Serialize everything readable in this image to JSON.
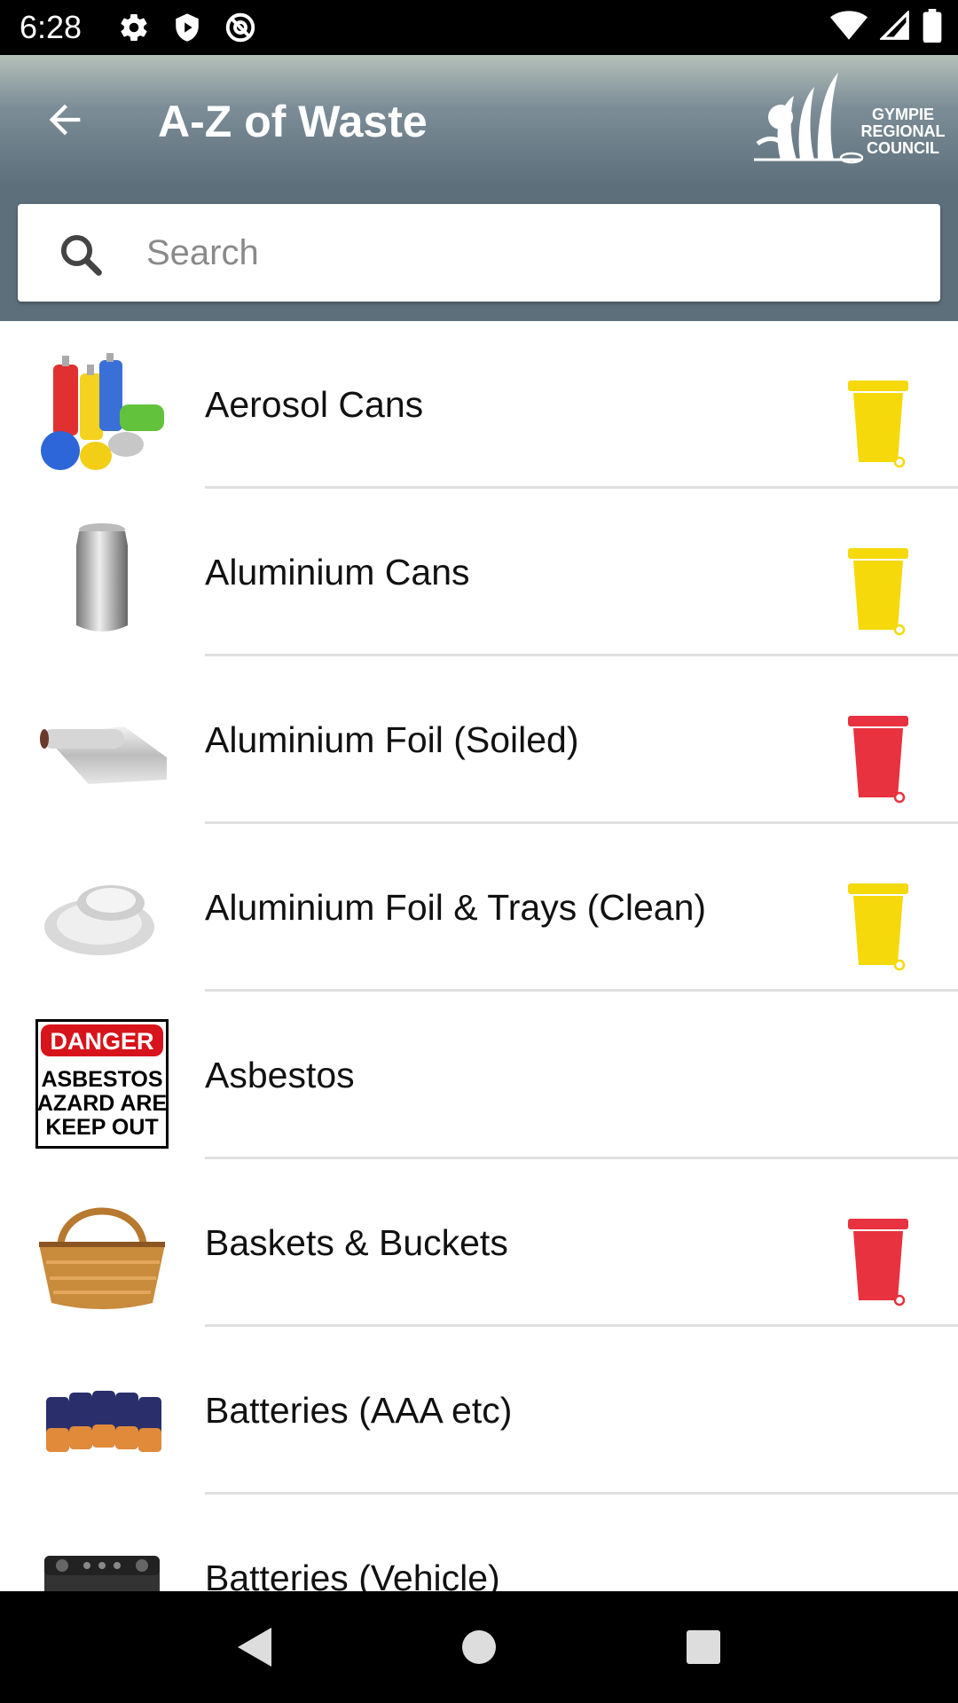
{
  "status_bar": {
    "time": "6:28",
    "left_icons": [
      "settings-icon",
      "shield-play-icon",
      "at-sign-icon"
    ],
    "right_icons": [
      "wifi-icon",
      "signal-icon",
      "battery-icon"
    ]
  },
  "app_bar": {
    "title": "A-Z of Waste",
    "back_icon": "arrow-back-icon",
    "logo_text": [
      "GYMPIE",
      "REGIONAL",
      "COUNCIL"
    ]
  },
  "search": {
    "placeholder": "Search",
    "value": ""
  },
  "colors": {
    "yellow_bin": "#f5d90a",
    "red_bin": "#e8323f",
    "header_dark": "#5d6f7b"
  },
  "items": [
    {
      "label": "Aerosol Cans",
      "bin": "yellow",
      "thumb": "aerosol-cans-image"
    },
    {
      "label": "Aluminium Cans",
      "bin": "yellow",
      "thumb": "aluminium-can-image"
    },
    {
      "label": "Aluminium Foil (Soiled)",
      "bin": "red",
      "thumb": "foil-roll-image"
    },
    {
      "label": "Aluminium Foil & Trays (Clean)",
      "bin": "yellow",
      "thumb": "foil-trays-image"
    },
    {
      "label": "Asbestos",
      "bin": "none",
      "thumb": "danger-sign-image",
      "sign_lines": [
        "DANGER",
        "ASBESTOS",
        "IAZARD ARE/",
        "KEEP OUT"
      ]
    },
    {
      "label": "Baskets & Buckets",
      "bin": "red",
      "thumb": "basket-image"
    },
    {
      "label": "Batteries (AAA etc)",
      "bin": "none",
      "thumb": "batteries-image"
    },
    {
      "label": "Batteries (Vehicle)",
      "bin": "none",
      "thumb": "car-battery-image"
    }
  ],
  "nav_bar": {
    "buttons": [
      "back-triangle-icon",
      "home-circle-icon",
      "recents-square-icon"
    ]
  }
}
